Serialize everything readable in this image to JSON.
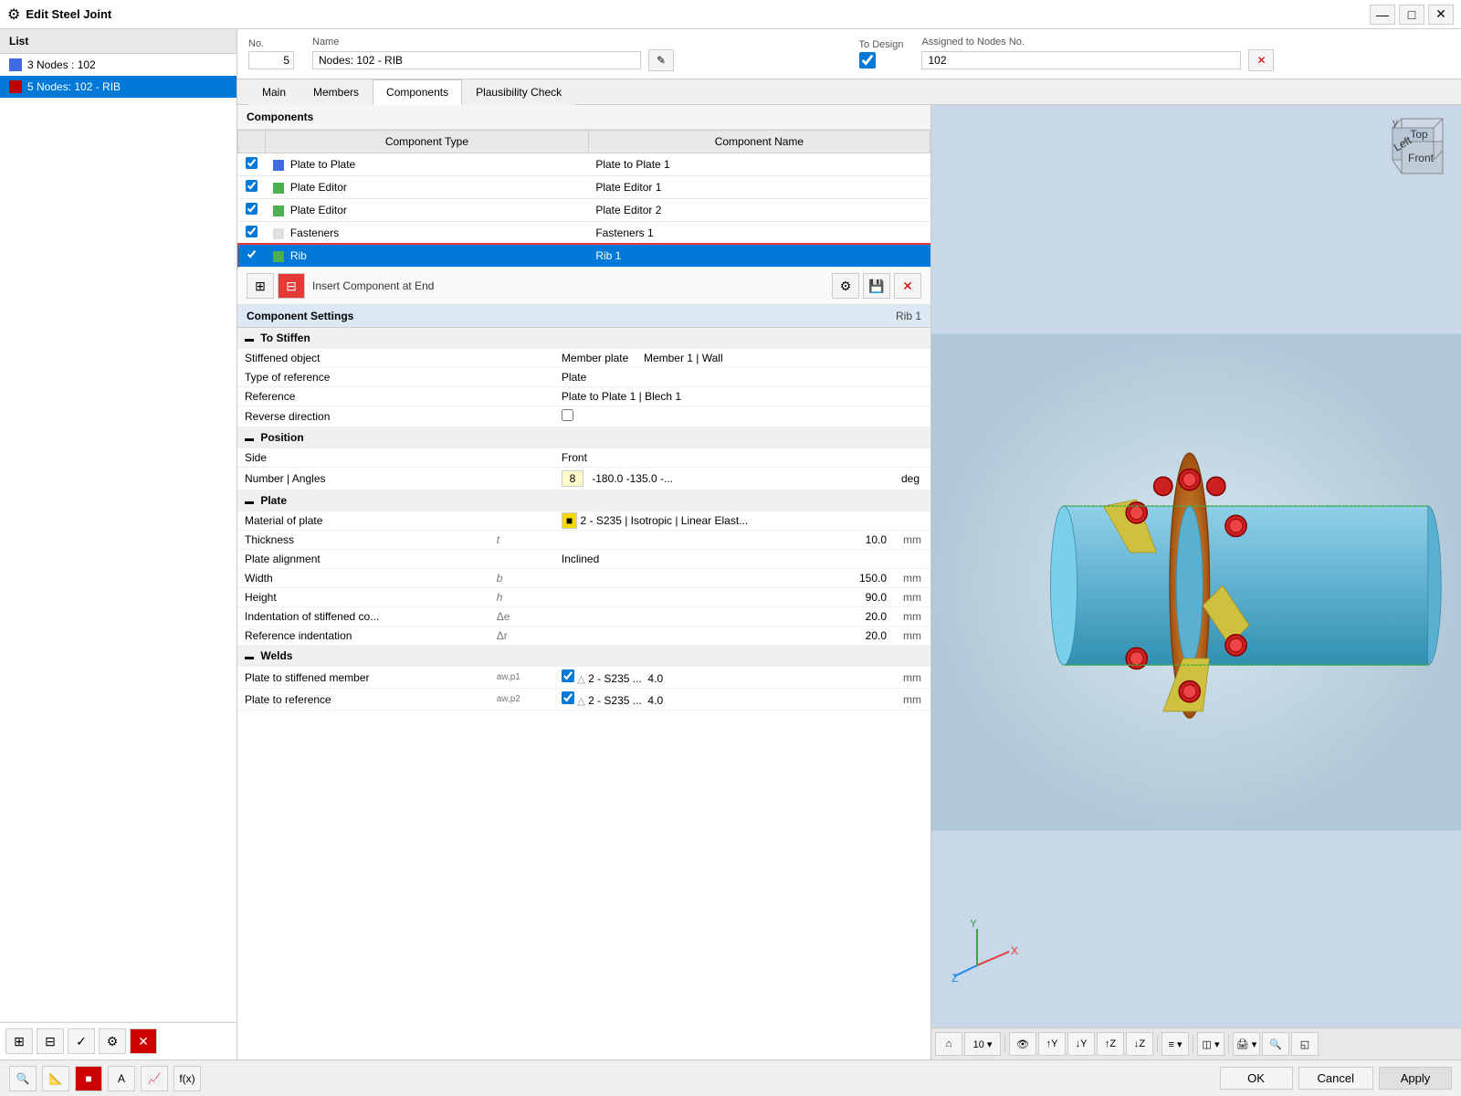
{
  "titleBar": {
    "icon": "⚙",
    "title": "Edit Steel Joint",
    "minimizeLabel": "—",
    "maximizeLabel": "□",
    "closeLabel": "✕"
  },
  "leftPanel": {
    "header": "List",
    "items": [
      {
        "id": "item1",
        "color": "#4169e1",
        "label": "3 Nodes : 102",
        "selected": false
      },
      {
        "id": "item2",
        "color": "#c00000",
        "label": "5 Nodes: 102 - RIB",
        "selected": true
      }
    ],
    "footerButtons": [
      "⊞",
      "⊟",
      "✓",
      "🔧",
      "✕"
    ]
  },
  "formArea": {
    "noLabel": "No.",
    "noValue": "5",
    "nameLabel": "Name",
    "nameValue": "Nodes: 102 - RIB",
    "toDesignLabel": "To Design",
    "toDesignChecked": true,
    "assignedLabel": "Assigned to Nodes No.",
    "assignedValue": "102"
  },
  "tabs": [
    {
      "id": "main",
      "label": "Main",
      "active": false
    },
    {
      "id": "members",
      "label": "Members",
      "active": false
    },
    {
      "id": "components",
      "label": "Components",
      "active": true
    },
    {
      "id": "plausibility",
      "label": "Plausibility Check",
      "active": false
    }
  ],
  "components": {
    "sectionTitle": "Components",
    "colType": "Component Type",
    "colName": "Component Name",
    "rows": [
      {
        "checked": true,
        "color": "#4169e1",
        "type": "Plate to Plate",
        "name": "Plate to Plate 1",
        "selected": false
      },
      {
        "checked": true,
        "color": "#4caf50",
        "type": "Plate Editor",
        "name": "Plate Editor 1",
        "selected": false
      },
      {
        "checked": true,
        "color": "#4caf50",
        "type": "Plate Editor",
        "name": "Plate Editor 2",
        "selected": false
      },
      {
        "checked": true,
        "color": "",
        "type": "Fasteners",
        "name": "Fasteners 1",
        "selected": false
      },
      {
        "checked": true,
        "color": "#4caf50",
        "type": "Rib",
        "name": "Rib 1",
        "selected": true
      }
    ],
    "toolbarButtons": [
      {
        "id": "btn1",
        "icon": "⊞"
      },
      {
        "id": "btn2",
        "icon": "⊟"
      },
      {
        "id": "btn3",
        "icon": "Insert Component at End",
        "isLabel": true
      },
      {
        "id": "btn4",
        "icon": "⚙"
      },
      {
        "id": "btn5",
        "icon": "💾"
      },
      {
        "id": "btn6",
        "icon": "✕",
        "isRed": true
      }
    ],
    "insertLabel": "Insert Component at End"
  },
  "componentSettings": {
    "title": "Component Settings",
    "name": "Rib 1",
    "groups": [
      {
        "id": "toStiffen",
        "label": "To Stiffen",
        "collapsed": false,
        "rows": [
          {
            "label": "Stiffened object",
            "symbol": "",
            "value": "Member plate",
            "extra": "Member 1 | Wall",
            "unit": ""
          },
          {
            "label": "Type of reference",
            "symbol": "",
            "value": "Plate",
            "extra": "",
            "unit": ""
          },
          {
            "label": "Reference",
            "symbol": "",
            "value": "Plate to Plate 1 | Blech 1",
            "extra": "",
            "unit": ""
          },
          {
            "label": "Reverse direction",
            "symbol": "",
            "value": "checkbox",
            "extra": "",
            "unit": ""
          }
        ]
      },
      {
        "id": "position",
        "label": "Position",
        "collapsed": false,
        "rows": [
          {
            "label": "Side",
            "symbol": "",
            "value": "Front",
            "extra": "",
            "unit": ""
          },
          {
            "label": "Number | Angles",
            "symbol": "",
            "valueYellow": "8",
            "value": "-180.0  -135.0 -...",
            "extra": "deg",
            "unit": ""
          }
        ]
      },
      {
        "id": "plate",
        "label": "Plate",
        "collapsed": false,
        "rows": [
          {
            "label": "Material of plate",
            "symbol": "",
            "value": "2 - S235 | Isotropic | Linear Elast...",
            "extra": "",
            "unit": "",
            "hasMaterial": true
          },
          {
            "label": "Thickness",
            "symbol": "t",
            "value": "10.0",
            "unit": "mm"
          },
          {
            "label": "Plate alignment",
            "symbol": "",
            "value": "Inclined",
            "unit": ""
          },
          {
            "label": "Width",
            "symbol": "b",
            "value": "150.0",
            "unit": "mm"
          },
          {
            "label": "Height",
            "symbol": "h",
            "value": "90.0",
            "unit": "mm"
          },
          {
            "label": "Indentation of stiffened co...",
            "symbol": "Δe",
            "value": "20.0",
            "unit": "mm"
          },
          {
            "label": "Reference indentation",
            "symbol": "Δr",
            "value": "20.0",
            "unit": "mm"
          }
        ]
      },
      {
        "id": "welds",
        "label": "Welds",
        "collapsed": false,
        "rows": [
          {
            "label": "Plate to stiffened member",
            "symbol": "aw,p1",
            "hasCheck": true,
            "weldIcon": true,
            "value": "2 - S235 ...",
            "extra": "4.0",
            "unit": "mm"
          },
          {
            "label": "Plate to reference",
            "symbol": "aw,p2",
            "hasCheck": true,
            "weldIcon": true,
            "value": "2 - S235 ...",
            "extra": "4.0",
            "unit": "mm"
          }
        ]
      }
    ]
  },
  "viewToolbar": {
    "buttons": [
      "□",
      "10▾",
      "👁",
      "↑Y",
      "↓Y",
      "↑Z",
      "↓Z",
      "≡▾",
      "◫▾",
      "🖨▾",
      "🔍",
      "◱"
    ]
  },
  "bottomBar": {
    "buttons": [
      "🔍",
      "📐",
      "🟥",
      "A",
      "📈",
      "f(x)"
    ],
    "okLabel": "OK",
    "cancelLabel": "Cancel",
    "applyLabel": "Apply"
  }
}
